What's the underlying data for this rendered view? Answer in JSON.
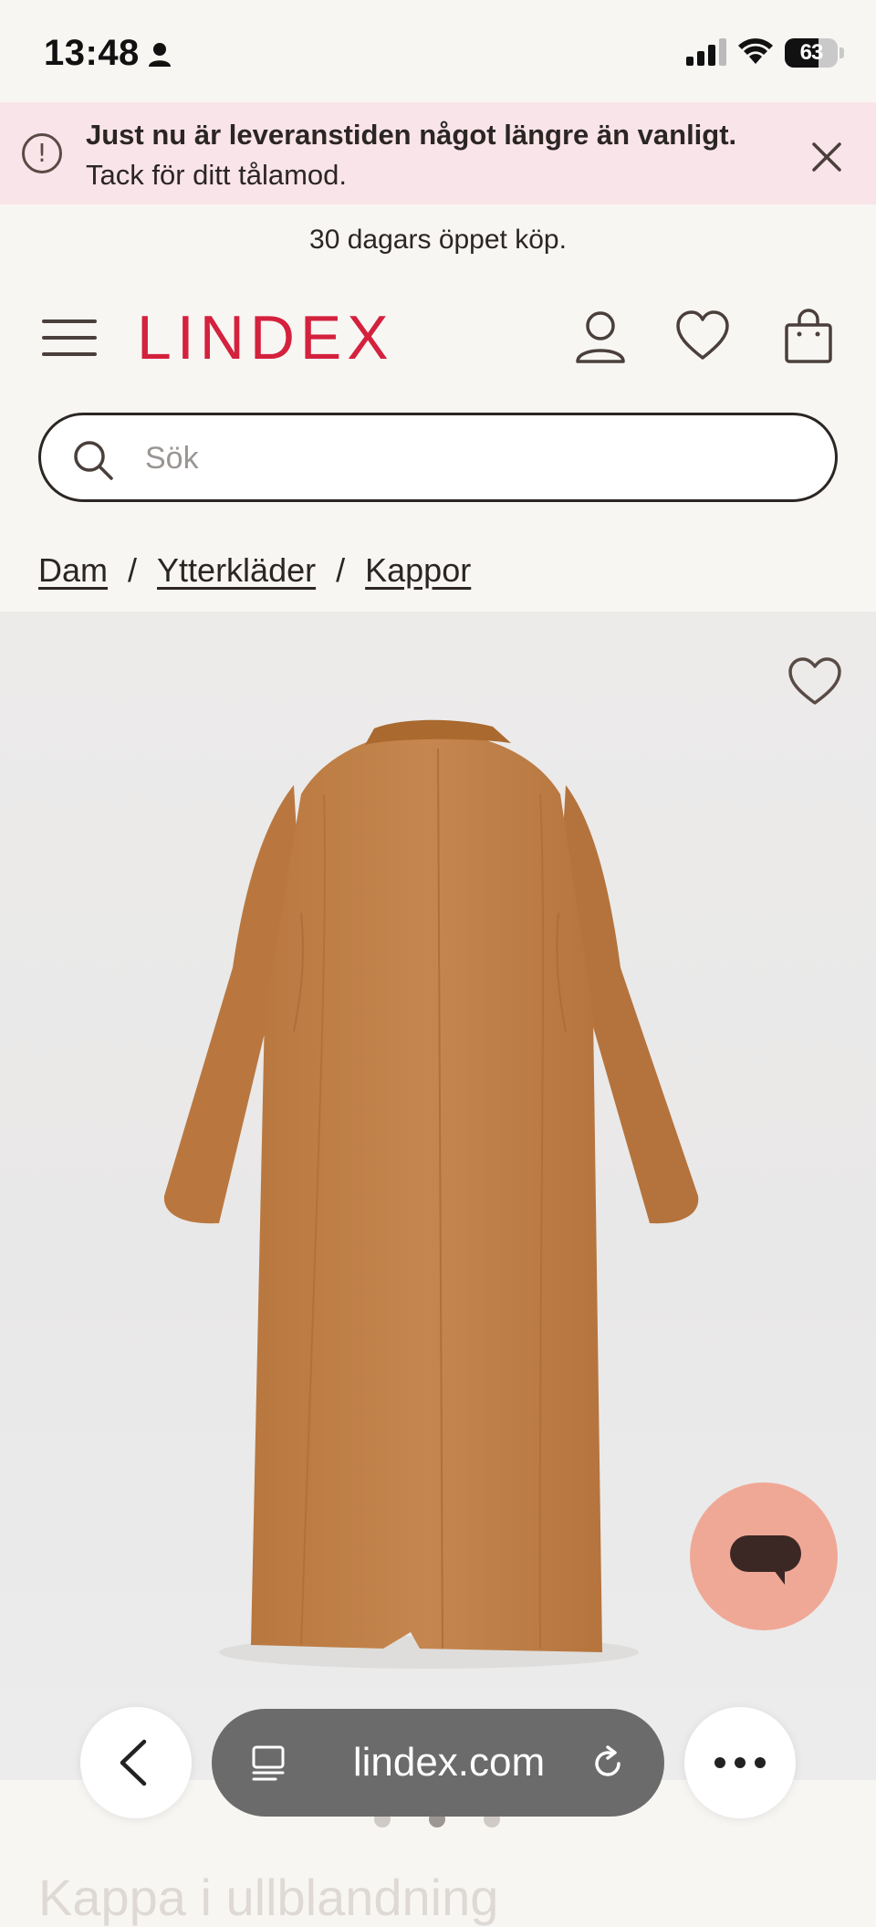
{
  "status_bar": {
    "time": "13:48",
    "battery": "63",
    "battery_level": 0.63
  },
  "notice": {
    "bold_text": "Just nu är leveranstiden något längre än vanligt.",
    "text": "Tack för ditt tålamod."
  },
  "promo": "30 dagars öppet köp.",
  "header": {
    "logo": "LINDEX",
    "brand_color": "#d4213d"
  },
  "search": {
    "placeholder": "Sök"
  },
  "breadcrumb": [
    "Dam",
    "Ytterkläder",
    "Kappor"
  ],
  "carousel": {
    "active_index": 1,
    "count": 3
  },
  "product_title_peek": "Kappa i ullblandning",
  "browser": {
    "url": "lindex.com"
  },
  "colors": {
    "notice_bg": "#f9e4ea",
    "chat_button": "#f0a896",
    "coat": "#c0814a"
  }
}
